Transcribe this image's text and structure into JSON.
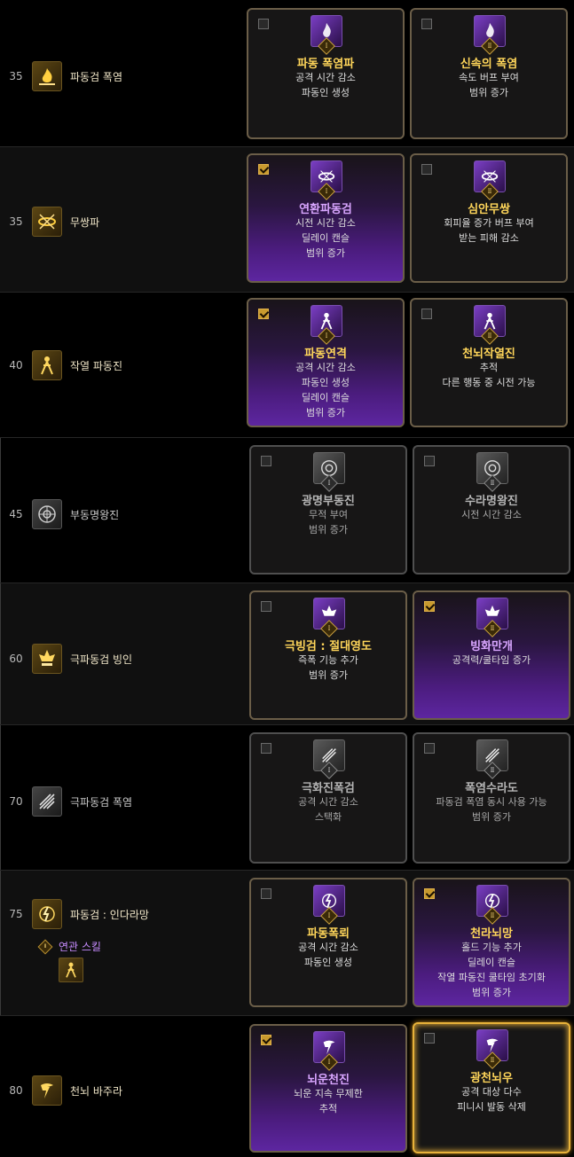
{
  "skills": [
    {
      "level": "35",
      "name": "파동검 폭염",
      "icon": "flame-burst-icon",
      "options": [
        {
          "tier": "Ⅰ",
          "title": "파동 폭염파",
          "desc": [
            "공격 시간 감소",
            "파동인 생성"
          ],
          "checked": false,
          "style": "plain",
          "icon": "flame-tier1-icon"
        },
        {
          "tier": "Ⅱ",
          "title": "신속의 폭염",
          "desc": [
            "속도 버프 부여",
            "범위 증가"
          ],
          "checked": false,
          "style": "plain",
          "icon": "flame-tier2-icon"
        }
      ]
    },
    {
      "level": "35",
      "name": "무쌍파",
      "icon": "swirl-blade-icon",
      "options": [
        {
          "tier": "Ⅰ",
          "title": "연환파동검",
          "desc": [
            "시전 시간 감소",
            "딜레이 캔슬",
            "범위 증가"
          ],
          "checked": true,
          "style": "selected",
          "icon": "swirl-tier1-icon"
        },
        {
          "tier": "Ⅱ",
          "title": "심안무쌍",
          "desc": [
            "회피율 증가 버프 부여",
            "받는 피해 감소"
          ],
          "checked": false,
          "style": "plain",
          "icon": "swirl-tier2-icon"
        }
      ]
    },
    {
      "level": "40",
      "name": "작열 파동진",
      "icon": "glowing-figure-icon",
      "options": [
        {
          "tier": "Ⅰ",
          "title": "파동연격",
          "desc": [
            "공격 시간 감소",
            "파동인 생성",
            "딜레이 캔슬",
            "범위 증가"
          ],
          "checked": true,
          "style": "selected",
          "icon": "figure-tier1-icon"
        },
        {
          "tier": "Ⅱ",
          "title": "천뇌작열진",
          "desc": [
            "추적",
            "다른 행동 중 시전 가능"
          ],
          "checked": false,
          "style": "plain",
          "icon": "figure-tier2-icon"
        }
      ]
    },
    {
      "level": "45",
      "name": "부동명왕진",
      "icon": "mandala-icon",
      "grey": true,
      "options": [
        {
          "tier": "Ⅰ",
          "title": "광명부동진",
          "desc": [
            "무적 부여",
            "범위 증가"
          ],
          "checked": false,
          "style": "grey",
          "icon": "mandala-tier1-icon"
        },
        {
          "tier": "Ⅱ",
          "title": "수라명왕진",
          "desc": [
            "시전 시간 감소"
          ],
          "checked": false,
          "style": "grey",
          "icon": "mandala-tier2-icon"
        }
      ]
    },
    {
      "level": "60",
      "name": "극파동검 빙인",
      "icon": "ice-crown-icon",
      "options": [
        {
          "tier": "Ⅰ",
          "title": "극빙검 : 절대영도",
          "desc": [
            "즉폭 기능 추가",
            "범위 증가"
          ],
          "checked": false,
          "style": "plain",
          "icon": "ice-tier1-icon"
        },
        {
          "tier": "Ⅱ",
          "title": "빙화만개",
          "desc": [
            "공격력/쿨타임 증가"
          ],
          "checked": true,
          "style": "selected",
          "icon": "ice-tier2-icon"
        }
      ]
    },
    {
      "level": "70",
      "name": "극파동검 폭염",
      "icon": "slash-storm-icon",
      "grey": true,
      "options": [
        {
          "tier": "Ⅰ",
          "title": "극화진폭검",
          "desc": [
            "공격 시간 감소",
            "스택화"
          ],
          "checked": false,
          "style": "grey",
          "icon": "slash-tier1-icon"
        },
        {
          "tier": "Ⅱ",
          "title": "폭염수라도",
          "desc": [
            "파동검 폭염 동시 사용 가능",
            "범위 증가"
          ],
          "checked": false,
          "style": "grey",
          "icon": "slash-tier2-icon"
        }
      ]
    },
    {
      "level": "75",
      "name": "파동검 : 인다라망",
      "icon": "lightning-orb-icon",
      "related_label": "연관 스킬",
      "related_tier": "Ⅱ",
      "related_icon": "related-figure-icon",
      "options": [
        {
          "tier": "Ⅰ",
          "title": "파동폭뢰",
          "desc": [
            "공격 시간 감소",
            "파동인 생성"
          ],
          "checked": false,
          "style": "plain",
          "icon": "orb-tier1-icon"
        },
        {
          "tier": "Ⅱ",
          "title": "천라뇌망",
          "desc": [
            "홀드 기능 추가",
            "딜레이 캔슬",
            "작열 파동진 쿨타임 초기화",
            "범위 증가"
          ],
          "checked": true,
          "style": "selected",
          "icon": "orb-tier2-icon"
        }
      ]
    },
    {
      "level": "80",
      "name": "천뇌 바주라",
      "icon": "thunder-icon",
      "options": [
        {
          "tier": "Ⅰ",
          "title": "뇌운천진",
          "desc": [
            "뇌운 지속 무제한",
            "추적"
          ],
          "checked": true,
          "style": "selected",
          "icon": "thunder-tier1-icon"
        },
        {
          "tier": "Ⅱ",
          "title": "광천뇌우",
          "desc": [
            "공격 대상 다수",
            "피니시 발동 삭제"
          ],
          "checked": false,
          "style": "highlight",
          "icon": "thunder-tier2-icon"
        }
      ]
    }
  ]
}
